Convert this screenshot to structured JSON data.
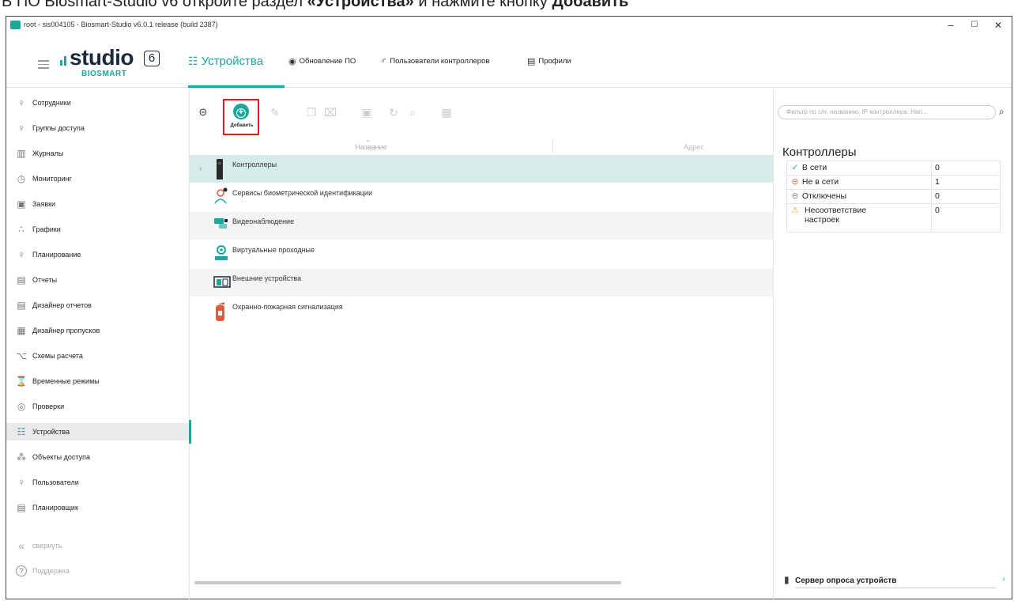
{
  "caption": {
    "part1": "В ПО Biosmart-Studio v6 откройте раздел ",
    "bold1": "«Устройства»",
    "part2": " и нажмите кнопку ",
    "bold2": "Добавить"
  },
  "window": {
    "title": "root - sis004105 - Biosmart-Studio v6.0.1 release (build 2387)",
    "controls": [
      "–",
      "☐",
      "✕"
    ]
  },
  "logo": {
    "word": "studio",
    "number": "6",
    "sub": "BIOSMART"
  },
  "tabs": [
    {
      "label": "Устройства",
      "icon": "devices-icon",
      "active": true
    },
    {
      "label": "Обновление ПО",
      "icon": "update-icon"
    },
    {
      "label": "Пользователи контроллеров",
      "icon": "user-icon"
    },
    {
      "label": "Профили",
      "icon": "profile-icon"
    }
  ],
  "sidebar": {
    "items": [
      {
        "label": "Сотрудники",
        "icon": "user-icon"
      },
      {
        "label": "Группы доступа",
        "icon": "group-icon"
      },
      {
        "label": "Журналы",
        "icon": "journal-icon"
      },
      {
        "label": "Мониторинг",
        "icon": "monitor-icon"
      },
      {
        "label": "Заявки",
        "icon": "request-icon"
      },
      {
        "label": "Графики",
        "icon": "chart-icon"
      },
      {
        "label": "Планирование",
        "icon": "planning-icon"
      },
      {
        "label": "Отчеты",
        "icon": "report-icon"
      },
      {
        "label": "Дизайнер отчетов",
        "icon": "report-designer-icon"
      },
      {
        "label": "Дизайнер пропусков",
        "icon": "pass-designer-icon"
      },
      {
        "label": "Схемы расчета",
        "icon": "scheme-icon"
      },
      {
        "label": "Временные режимы",
        "icon": "time-mode-icon"
      },
      {
        "label": "Проверки",
        "icon": "check-icon"
      },
      {
        "label": "Устройства",
        "icon": "devices-icon",
        "active": true
      },
      {
        "label": "Объекты доступа",
        "icon": "access-objects-icon"
      },
      {
        "label": "Пользователи",
        "icon": "users-icon"
      },
      {
        "label": "Планировщик",
        "icon": "scheduler-icon"
      }
    ],
    "collapse_label": "свернуть",
    "support_label": "Поддержка"
  },
  "toolbar": {
    "add_label": "Добавить"
  },
  "grid": {
    "col_name": "Название",
    "col_address": "Адрес",
    "rows": [
      {
        "label": "Контроллеры",
        "icon": "controller-icon",
        "selected": true,
        "expandable": true
      },
      {
        "label": "Сервисы биометрической идентификации",
        "icon": "biometric-icon"
      },
      {
        "label": "Видеонаблюдение",
        "icon": "video-icon"
      },
      {
        "label": "Виртуальные проходные",
        "icon": "virtual-pass-icon"
      },
      {
        "label": "Внешние устройства",
        "icon": "external-devices-icon"
      },
      {
        "label": "Охранно-пожарная сигнализация",
        "icon": "fire-alarm-icon"
      }
    ]
  },
  "filter": {
    "placeholder": "Фильтр по с/н, названию, IP контроллера. Нап..."
  },
  "status_panel": {
    "title": "Контроллеры",
    "rows": [
      {
        "label": "В сети",
        "value": "0",
        "icon": "online-icon",
        "color": "#1aa89b"
      },
      {
        "label": "Не в сети",
        "value": "1",
        "icon": "offline-icon",
        "color": "#e35a3a"
      },
      {
        "label": "Отключены",
        "value": "0",
        "icon": "disabled-icon",
        "color": "#777777"
      },
      {
        "label": "Несоответствие настроек",
        "value": "0",
        "icon": "warning-icon",
        "color": "#f0a020"
      }
    ]
  },
  "server": {
    "label": "Сервер опроса устройств"
  },
  "colors": {
    "accent": "#1aa89b",
    "highlight": "#e11c1c"
  }
}
